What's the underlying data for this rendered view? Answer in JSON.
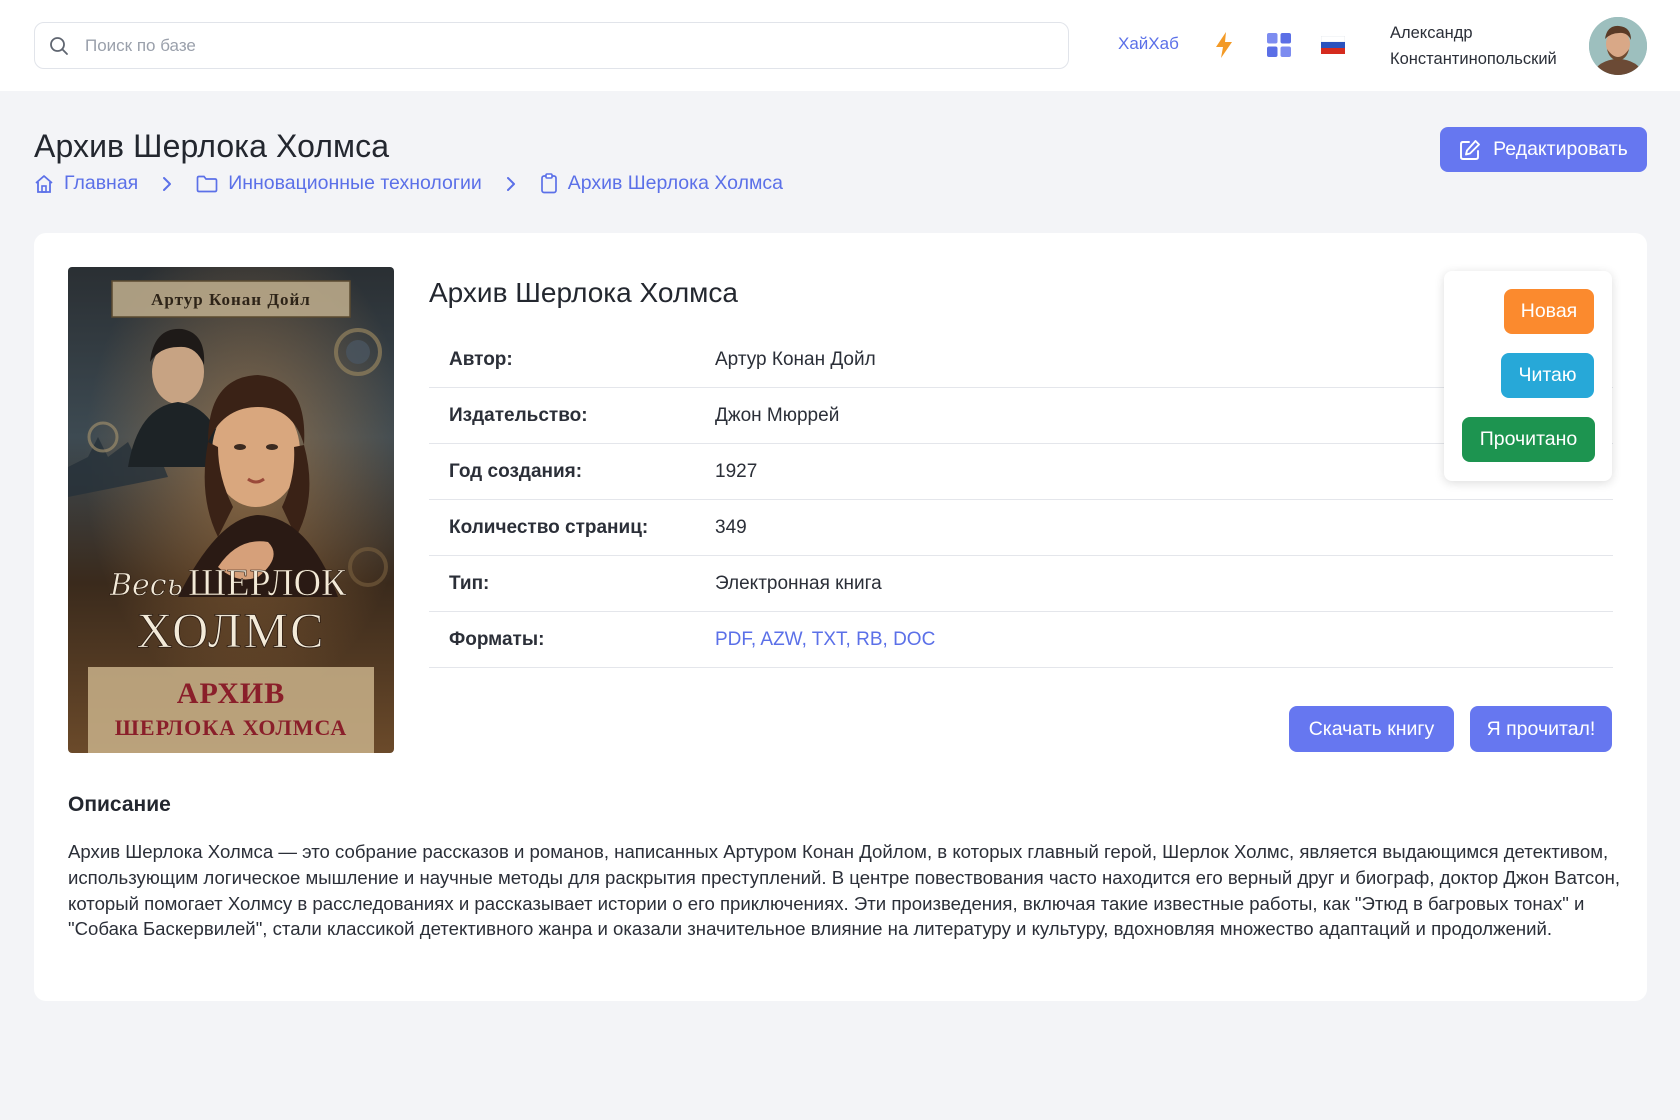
{
  "search": {
    "placeholder": "Поиск по базе"
  },
  "header": {
    "hub_link": "ХайХаб",
    "user_name_line1": "Александр",
    "user_name_line2": "Константинопольский"
  },
  "page": {
    "title": "Архив Шерлока Холмса",
    "edit_label": "Редактировать"
  },
  "breadcrumb": {
    "home": "Главная",
    "category": "Инновационные технологии",
    "current": "Архив Шерлока Холмса"
  },
  "cover": {
    "author_banner": "Артур Конан Дойл",
    "series_line1": "Весь",
    "series_line2": "ШЕРЛОК",
    "series_line3": "ХОЛМС",
    "book_line1": "АРХИВ",
    "book_line2": "ШЕРЛОКА ХОЛМСА"
  },
  "book": {
    "title": "Архив Шерлока Холмса",
    "properties": [
      {
        "label": "Автор:",
        "value": "Артур Конан Дойл"
      },
      {
        "label": "Издательство:",
        "value": "Джон Мюррей"
      },
      {
        "label": "Год создания:",
        "value": "1927"
      },
      {
        "label": "Количество страниц:",
        "value": "349"
      },
      {
        "label": "Тип:",
        "value": "Электронная книга"
      },
      {
        "label": "Форматы:",
        "value": "PDF, AZW, TXT, RB, DOC"
      }
    ]
  },
  "status": {
    "new": "Новая",
    "reading": "Читаю",
    "done": "Прочитано"
  },
  "actions": {
    "download": "Скачать книгу",
    "read": "Я прочитал!"
  },
  "description": {
    "title": "Описание",
    "text": "Архив Шерлока Холмса — это собрание рассказов и романов, написанных Артуром Конан Дойлом, в которых главный герой, Шерлок Холмс, является выдающимся детективом, использующим логическое мышление и научные методы для раскрытия преступлений. В центре повествования часто находится его верный друг и биограф, доктор Джон Ватсон, который помогает Холмсу в расследованиях и рассказывает истории о его приключениях. Эти произведения, включая такие известные работы, как \"Этюд в багровых тонах\" и \"Собака Баскервилей\", стали классикой детективного жанра и оказали значительное влияние на литературу и культуру, вдохновляя множество адаптаций и продолжений."
  },
  "colors": {
    "accent": "#6677f0",
    "link": "#5b70e8",
    "status_new": "#fb8a2e",
    "status_reading": "#27a8d8",
    "status_done": "#1d9450",
    "bolt": "#f39a26"
  },
  "icons": {
    "search": "search-icon",
    "bolt": "bolt-icon",
    "apps": "apps-grid-icon",
    "flag": "russian-flag-icon",
    "home": "home-icon",
    "folder": "folder-icon",
    "clipboard": "clipboard-icon",
    "edit": "edit-icon"
  }
}
